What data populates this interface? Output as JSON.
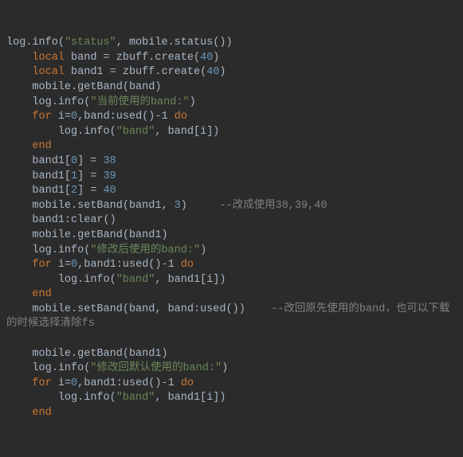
{
  "chart_data": null,
  "kw": {
    "local": "local",
    "for": "for",
    "do": "do",
    "end": "end"
  },
  "id": {
    "log": "log",
    "info": "info",
    "mobile": "mobile",
    "status": "status",
    "band": "band",
    "band1": "band1",
    "zbuff": "zbuff",
    "create": "create",
    "getBand": "getBand",
    "setBand": "setBand",
    "used": "used",
    "clear": "clear",
    "i": "i"
  },
  "str": {
    "status": "\"status\"",
    "cur_band": "\"当前使用的band:\"",
    "band": "\"band\"",
    "after_mod": "\"修改后使用的band:\"",
    "after_restore": "\"修改回默认使用的band:\""
  },
  "num": {
    "n40": "40",
    "n0": "0",
    "n1": "1",
    "n2": "2",
    "n3": "3",
    "n38": "38",
    "n39": "39"
  },
  "cmt": {
    "c1": "--改成使用38,39,40",
    "c2": "--改回原先使用的band，也可以下载的时候选择清除fs"
  },
  "punc": {
    "dot": ".",
    "lp": "(",
    "rp": ")",
    "cm": ", ",
    "cmn": ",",
    "eq": " = ",
    "eqn": "=",
    "lb": "[",
    "rb": "]",
    "m1": "-1",
    "colon": ":"
  }
}
